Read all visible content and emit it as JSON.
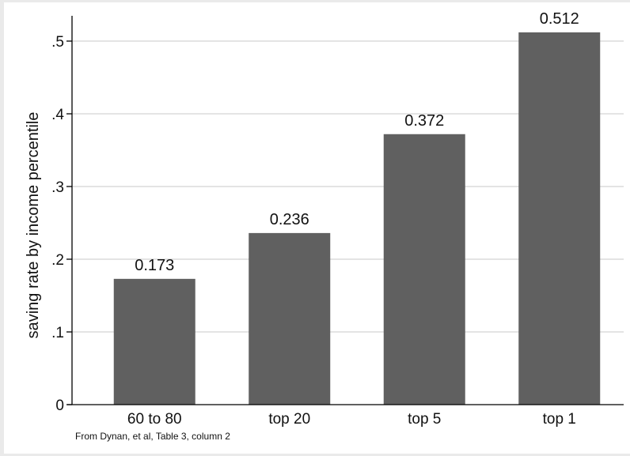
{
  "chart_data": {
    "type": "bar",
    "title": "",
    "xlabel": "",
    "ylabel": "saving rate by income percentile",
    "categories": [
      "60 to 80",
      "top 20",
      "top 5",
      "top 1"
    ],
    "values": [
      0.173,
      0.236,
      0.372,
      0.512
    ],
    "value_labels": [
      "0.173",
      "0.236",
      "0.372",
      "0.512"
    ],
    "ylim": [
      0,
      0.5
    ],
    "yticks": [
      0,
      0.1,
      0.2,
      0.3,
      0.4,
      0.5
    ],
    "ytick_labels": [
      "0",
      ".1",
      ".2",
      ".3",
      ".4",
      ".5"
    ],
    "grid": true,
    "bar_color": "#606060",
    "grid_color": "#dcdcdc",
    "note": "From Dynan, et al, Table 3, column 2"
  }
}
